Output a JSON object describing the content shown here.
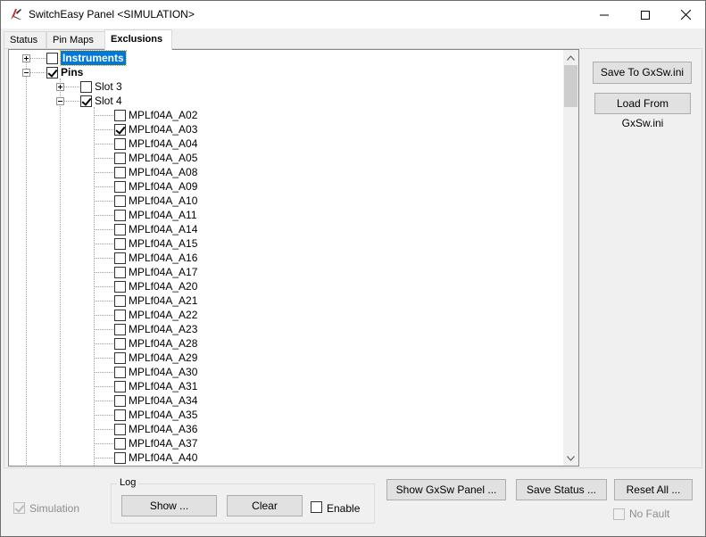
{
  "window": {
    "title": "SwitchEasy Panel <SIMULATION>",
    "controls": [
      "minimize",
      "maximize",
      "close"
    ]
  },
  "tabs": [
    {
      "label": "Status",
      "active": false
    },
    {
      "label": "Pin Maps",
      "active": false
    },
    {
      "label": "Exclusions",
      "active": true
    }
  ],
  "tree": {
    "instruments": {
      "label": "Instruments",
      "checked": false,
      "expanded": false,
      "selected": true
    },
    "pins": {
      "label": "Pins",
      "checked": true,
      "expanded": true
    },
    "slot3": {
      "label": "Slot 3",
      "checked": false,
      "expanded": false
    },
    "slot4": {
      "label": "Slot 4",
      "checked": true,
      "expanded": true
    },
    "pin_items": [
      {
        "label": "MPLf04A_A02",
        "checked": false
      },
      {
        "label": "MPLf04A_A03",
        "checked": true
      },
      {
        "label": "MPLf04A_A04",
        "checked": false
      },
      {
        "label": "MPLf04A_A05",
        "checked": false
      },
      {
        "label": "MPLf04A_A08",
        "checked": false
      },
      {
        "label": "MPLf04A_A09",
        "checked": false
      },
      {
        "label": "MPLf04A_A10",
        "checked": false
      },
      {
        "label": "MPLf04A_A11",
        "checked": false
      },
      {
        "label": "MPLf04A_A14",
        "checked": false
      },
      {
        "label": "MPLf04A_A15",
        "checked": false
      },
      {
        "label": "MPLf04A_A16",
        "checked": false
      },
      {
        "label": "MPLf04A_A17",
        "checked": false
      },
      {
        "label": "MPLf04A_A20",
        "checked": false
      },
      {
        "label": "MPLf04A_A21",
        "checked": false
      },
      {
        "label": "MPLf04A_A22",
        "checked": false
      },
      {
        "label": "MPLf04A_A23",
        "checked": false
      },
      {
        "label": "MPLf04A_A28",
        "checked": false
      },
      {
        "label": "MPLf04A_A29",
        "checked": false
      },
      {
        "label": "MPLf04A_A30",
        "checked": false
      },
      {
        "label": "MPLf04A_A31",
        "checked": false
      },
      {
        "label": "MPLf04A_A34",
        "checked": false
      },
      {
        "label": "MPLf04A_A35",
        "checked": false
      },
      {
        "label": "MPLf04A_A36",
        "checked": false
      },
      {
        "label": "MPLf04A_A37",
        "checked": false
      },
      {
        "label": "MPLf04A_A40",
        "checked": false
      }
    ]
  },
  "side_buttons": {
    "save": "Save To GxSw.ini",
    "load": "Load From GxSw.ini"
  },
  "bottom": {
    "simulation": {
      "label": "Simulation",
      "checked": true,
      "disabled": true
    },
    "log": {
      "title": "Log",
      "show": "Show ...",
      "clear": "Clear",
      "enable": {
        "label": "Enable",
        "checked": false
      }
    },
    "show_panel": "Show GxSw Panel ...",
    "save_status": "Save Status ...",
    "reset_all": "Reset All ...",
    "no_fault": {
      "label": "No Fault",
      "checked": false,
      "disabled": true
    }
  },
  "colors": {
    "selection": "#0078d7",
    "background": "#f0f0f0",
    "button": "#e1e1e1"
  }
}
